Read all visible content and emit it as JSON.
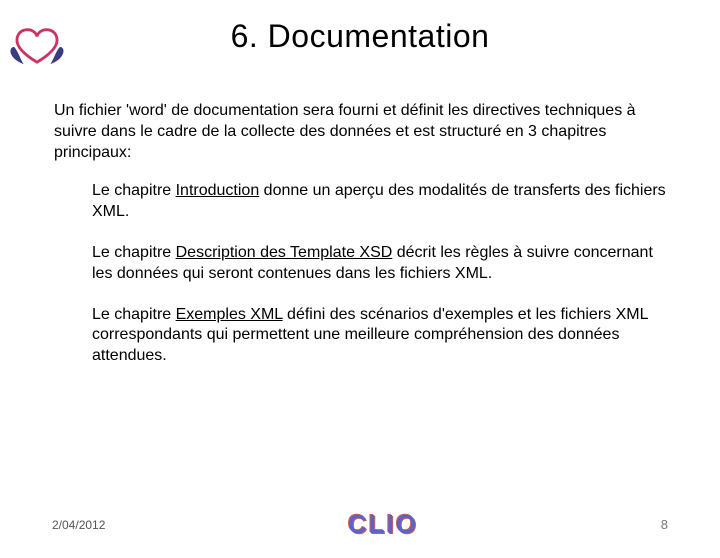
{
  "title": "6. Documentation",
  "intro": "Un fichier 'word' de documentation sera fourni et définit les directives techniques à suivre dans le cadre de la collecte des données et est structuré en 3 chapitres principaux:",
  "ch1a": "Le chapitre ",
  "ch1u": "Introduction",
  "ch1b": " donne un aperçu des modalités de transferts des fichiers XML.",
  "ch2a": "Le chapitre ",
  "ch2u": "Description des Template XSD",
  "ch2b": " décrit les règles à suivre concernant les données qui seront contenues dans les fichiers XML.",
  "ch3a": "Le chapitre ",
  "ch3u": "Exemples XML",
  "ch3b": " défini des scénarios d'exemples et les fichiers XML correspondants qui permettent une meilleure compréhension des données attendues.",
  "footer": {
    "date": "2/04/2012",
    "logo": "CLIO",
    "page": "8"
  }
}
